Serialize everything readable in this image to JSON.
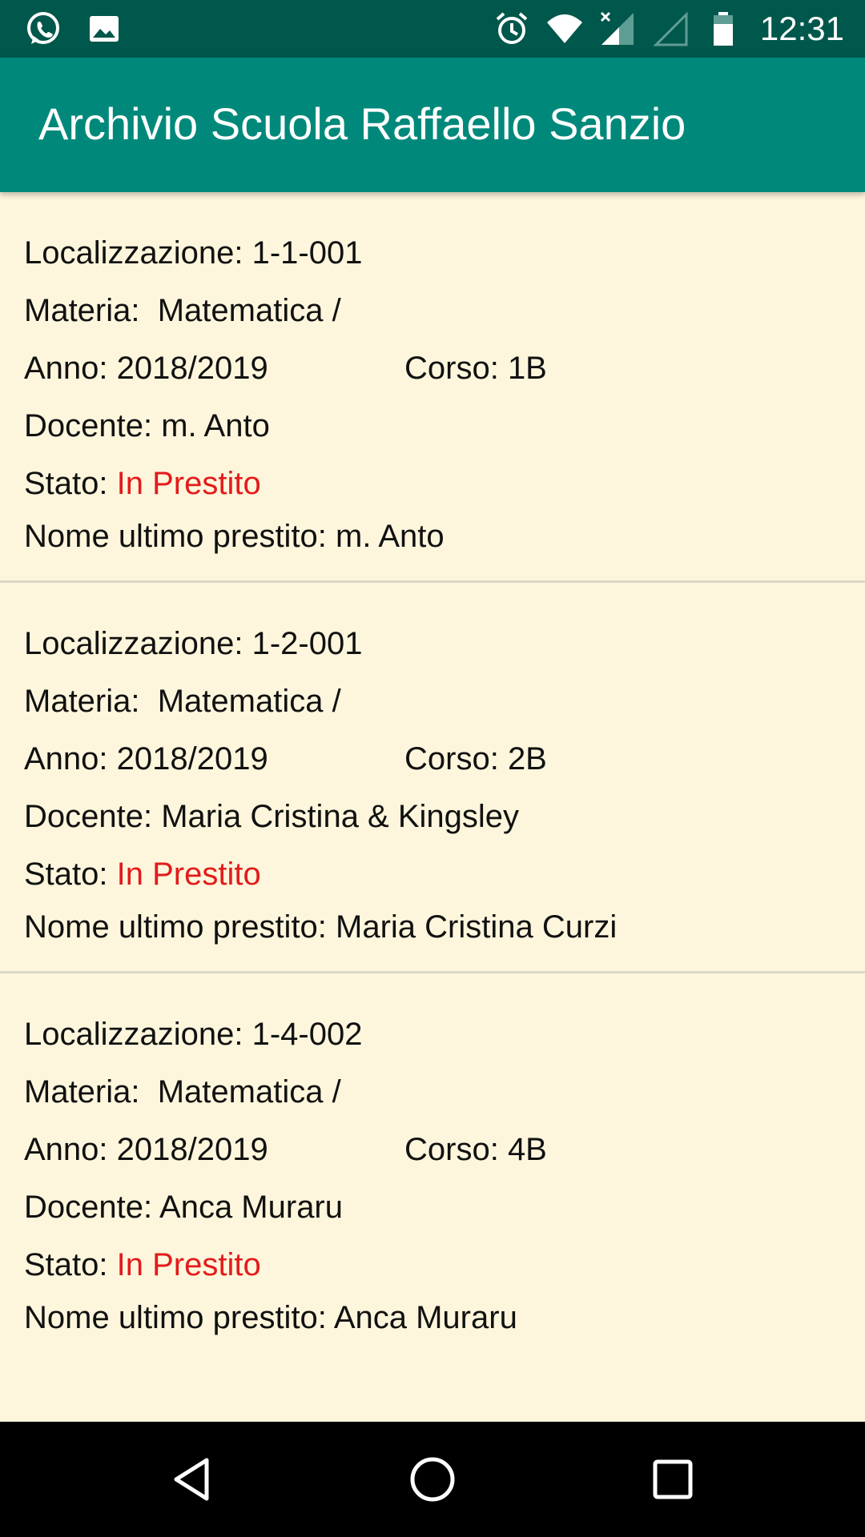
{
  "status_bar": {
    "time": "12:31",
    "left_icons": [
      "whatsapp-icon",
      "image-icon"
    ],
    "right_icons": [
      "alarm-icon",
      "wifi-icon",
      "signal-icon",
      "signal-empty-icon",
      "battery-icon"
    ]
  },
  "app_bar": {
    "title": "Archivio Scuola Raffaello Sanzio",
    "color": "#00897b"
  },
  "colors": {
    "status_bar": "#00574b",
    "background": "#fdf6dc",
    "status_value": "#e31b1b"
  },
  "labels": {
    "localizzazione": "Localizzazione: ",
    "materia": "Materia:  ",
    "anno": "Anno: ",
    "corso": "Corso: ",
    "docente": "Docente: ",
    "stato": "Stato: ",
    "ultimo": "Nome ultimo prestito: "
  },
  "records": [
    {
      "localizzazione": "1-1-001",
      "materia": "Matematica /",
      "anno": "2018/2019",
      "corso": "1B",
      "docente": "m. Anto",
      "stato": "In Prestito",
      "ultimo": "m. Anto"
    },
    {
      "localizzazione": "1-2-001",
      "materia": "Matematica /",
      "anno": "2018/2019",
      "corso": "2B",
      "docente": "Maria Cristina & Kingsley",
      "stato": "In Prestito",
      "ultimo": "Maria Cristina Curzi"
    },
    {
      "localizzazione": "1-4-002",
      "materia": "Matematica /",
      "anno": "2018/2019",
      "corso": "4B",
      "docente": "Anca Muraru",
      "stato": "In Prestito",
      "ultimo": "Anca Muraru"
    }
  ],
  "nav_bar": {
    "buttons": [
      "back-icon",
      "home-icon",
      "recents-icon"
    ]
  }
}
